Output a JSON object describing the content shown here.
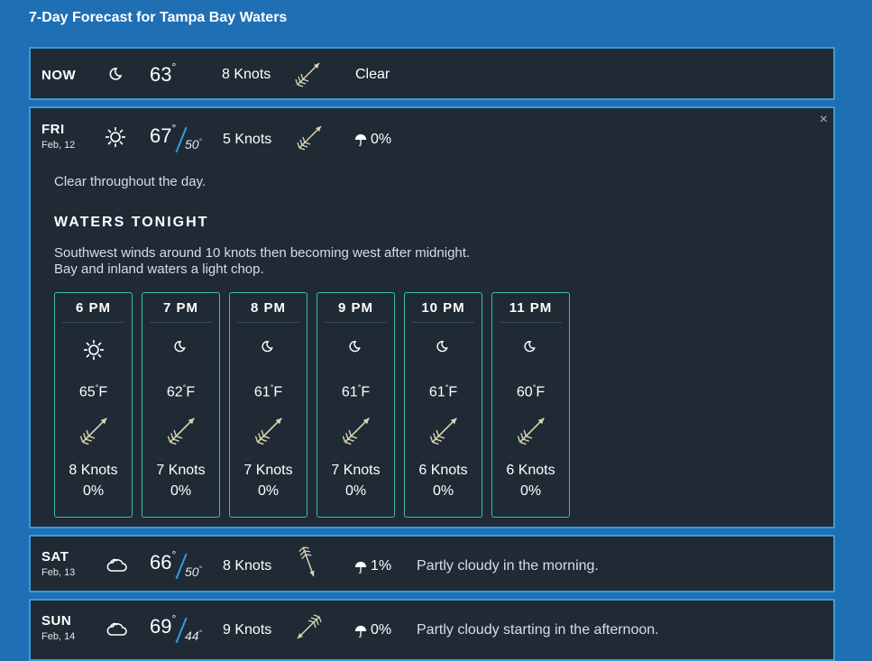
{
  "page": {
    "title": "7-Day Forecast for Tampa Bay Waters"
  },
  "now": {
    "label": "NOW",
    "icon": "moon-icon",
    "temp": "63",
    "degree": "°",
    "wind": "8 Knots",
    "condition": "Clear"
  },
  "friday": {
    "day": "FRI",
    "date": "Feb, 12",
    "icon": "sun-icon",
    "high": "67",
    "low": "50",
    "degree": "°",
    "wind": "5 Knots",
    "precip": "0%",
    "close": "×",
    "summary": "Clear throughout the day.",
    "waters_title": "WATERS TONIGHT",
    "waters_line1": "Southwest winds around 10 knots then becoming west after midnight.",
    "waters_line2": "Bay and inland waters a light chop.",
    "hours": [
      {
        "time": "6 PM",
        "icon": "sun-icon",
        "temp": "65",
        "unit": "F",
        "wind": "8 Knots",
        "pop": "0%"
      },
      {
        "time": "7 PM",
        "icon": "moon-icon",
        "temp": "62",
        "unit": "F",
        "wind": "7 Knots",
        "pop": "0%"
      },
      {
        "time": "8 PM",
        "icon": "moon-icon",
        "temp": "61",
        "unit": "F",
        "wind": "7 Knots",
        "pop": "0%"
      },
      {
        "time": "9 PM",
        "icon": "moon-icon",
        "temp": "61",
        "unit": "F",
        "wind": "7 Knots",
        "pop": "0%"
      },
      {
        "time": "10 PM",
        "icon": "moon-icon",
        "temp": "61",
        "unit": "F",
        "wind": "6 Knots",
        "pop": "0%"
      },
      {
        "time": "11 PM",
        "icon": "moon-icon",
        "temp": "60",
        "unit": "F",
        "wind": "6 Knots",
        "pop": "0%"
      }
    ]
  },
  "saturday": {
    "day": "SAT",
    "date": "Feb, 13",
    "icon": "partly-cloudy-icon",
    "high": "66",
    "low": "50",
    "degree": "°",
    "wind": "8 Knots",
    "precip": "1%",
    "summary": "Partly cloudy in the morning."
  },
  "sunday": {
    "day": "SUN",
    "date": "Feb, 14",
    "icon": "partly-cloudy-icon",
    "high": "69",
    "low": "44",
    "degree": "°",
    "wind": "9 Knots",
    "precip": "0%",
    "summary": "Partly cloudy starting in the afternoon."
  },
  "colors": {
    "background": "#1f6fb5",
    "card": "#1f2a35",
    "border": "#3a9ad9",
    "hour_border": "#3cbdb0",
    "arrow": "#d8d4b0"
  }
}
